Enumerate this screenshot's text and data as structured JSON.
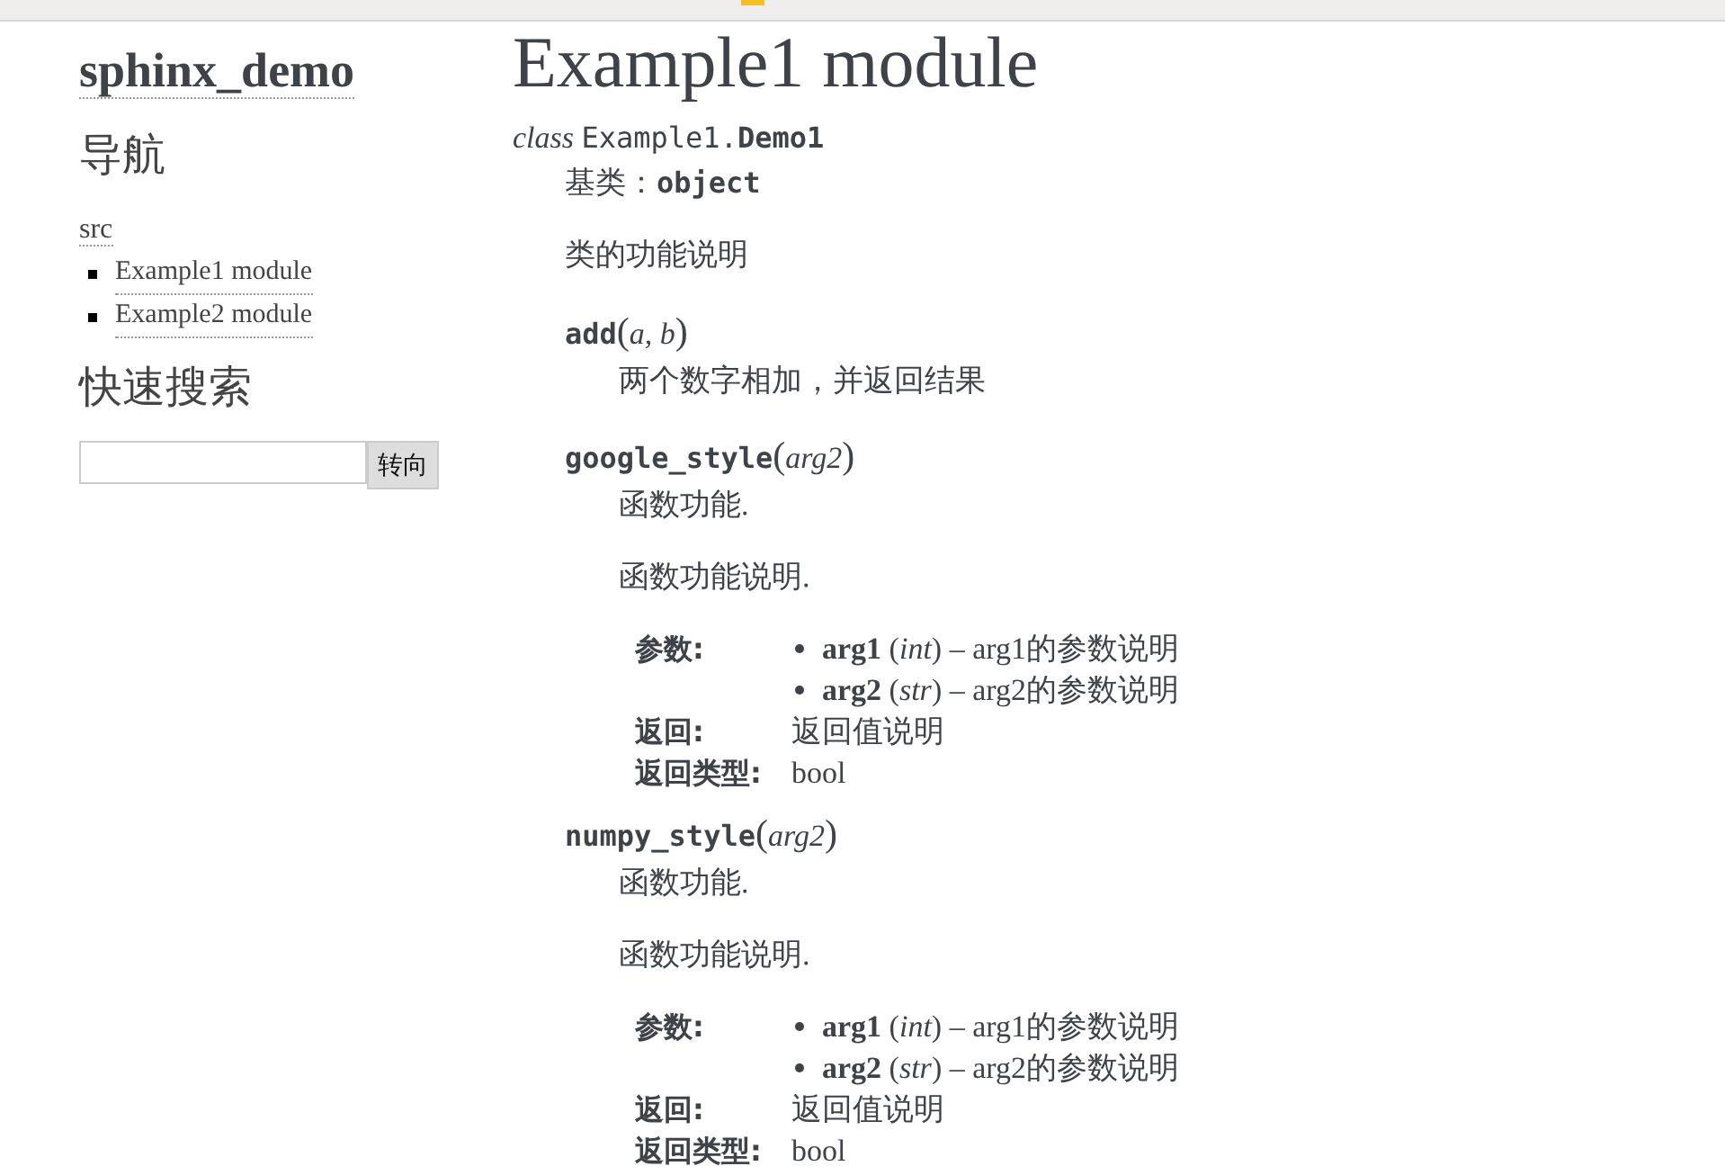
{
  "sidebar": {
    "logo": "sphinx_demo",
    "nav_heading": "导航",
    "nav_root": "src",
    "nav_items": [
      "Example1 module",
      "Example2 module"
    ],
    "search_heading": "快速搜索",
    "search_button": "转向"
  },
  "content": {
    "title": "Example1 module",
    "class_signature": {
      "keyword": "class",
      "module": "Example1.",
      "name": "Demo1"
    },
    "bases": {
      "label": "基类：",
      "value": "object"
    },
    "description": "类的功能说明",
    "methods": [
      {
        "name": "add",
        "open": "(",
        "params": "a, b",
        "close": ")",
        "paragraphs": [
          "两个数字相加，并返回结果"
        ]
      },
      {
        "name": "google_style",
        "open": "(",
        "params": "arg2",
        "close": ")",
        "paragraphs": [
          "函数功能.",
          "函数功能说明."
        ],
        "fields": [
          {
            "kind": "list",
            "label": "参数:",
            "items": [
              "**arg1** (*int*) – arg1的参数说明",
              "**arg2** (*str*) – arg2的参数说明"
            ]
          },
          {
            "kind": "text",
            "label": "返回:",
            "value": "返回值说明"
          },
          {
            "kind": "text",
            "label": "返回类型:",
            "value": "bool"
          }
        ]
      },
      {
        "name": "numpy_style",
        "open": "(",
        "params": "arg2",
        "close": ")",
        "paragraphs": [
          "函数功能.",
          "函数功能说明."
        ],
        "fields": [
          {
            "kind": "list",
            "label": "参数:",
            "items": [
              "**arg1** (*int*) – arg1的参数说明",
              "**arg2** (*str*) – arg2的参数说明"
            ]
          },
          {
            "kind": "text",
            "label": "返回:",
            "value": "返回值说明"
          },
          {
            "kind": "text",
            "label": "返回类型:",
            "value": "bool"
          }
        ]
      }
    ]
  }
}
